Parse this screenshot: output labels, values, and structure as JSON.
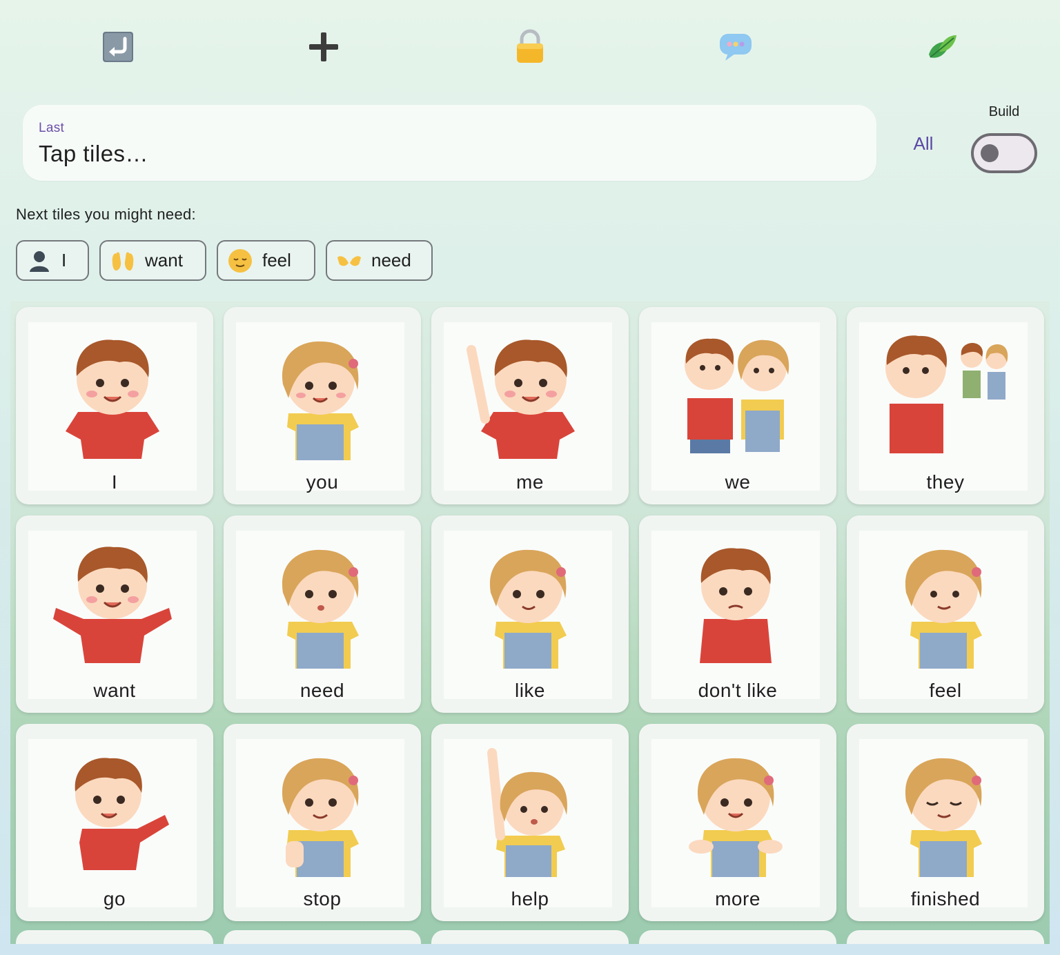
{
  "toolbar": {
    "icons": [
      "return-icon",
      "plus-icon",
      "lock-icon",
      "speech-bubble-icon",
      "leaf-icon"
    ]
  },
  "sentence": {
    "label": "Last",
    "text": "Tap tiles…"
  },
  "controls": {
    "all_label": "All",
    "build_label": "Build",
    "build_on": false
  },
  "suggestions": {
    "heading": "Next tiles you might need:",
    "chips": [
      {
        "label": "I",
        "icon": "person-silhouette-icon"
      },
      {
        "label": "want",
        "icon": "raised-hands-icon"
      },
      {
        "label": "feel",
        "icon": "relieved-face-icon"
      },
      {
        "label": "need",
        "icon": "open-hands-icon"
      }
    ]
  },
  "tiles": [
    {
      "word": "I",
      "figure": "boy"
    },
    {
      "word": "you",
      "figure": "girl"
    },
    {
      "word": "me",
      "figure": "boy"
    },
    {
      "word": "we",
      "figure": "boy-girl"
    },
    {
      "word": "they",
      "figure": "boy-group"
    },
    {
      "word": "want",
      "figure": "boy"
    },
    {
      "word": "need",
      "figure": "girl"
    },
    {
      "word": "like",
      "figure": "girl"
    },
    {
      "word": "don't like",
      "figure": "boy"
    },
    {
      "word": "feel",
      "figure": "girl"
    },
    {
      "word": "go",
      "figure": "boy"
    },
    {
      "word": "stop",
      "figure": "girl"
    },
    {
      "word": "help",
      "figure": "girl"
    },
    {
      "word": "more",
      "figure": "girl"
    },
    {
      "word": "finished",
      "figure": "girl"
    }
  ],
  "colors": {
    "accent": "#5b47a6",
    "boy_shirt": "#d9443a",
    "girl_overall": "#8fa9c9",
    "hair_boy": "#a8582a",
    "hair_girl": "#d9a55a"
  }
}
